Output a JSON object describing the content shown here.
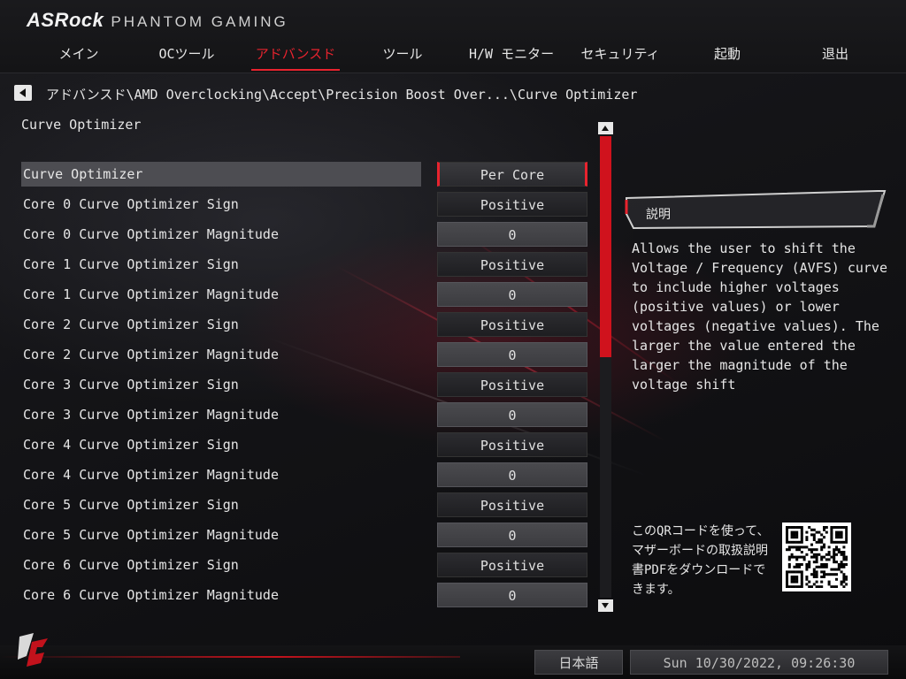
{
  "brand": {
    "logo": "ASRock",
    "subtitle": "PHANTOM GAMING"
  },
  "tabs": [
    {
      "label": "メイン"
    },
    {
      "label": "OCツール"
    },
    {
      "label": "アドバンスド",
      "active": true
    },
    {
      "label": "ツール"
    },
    {
      "label": "H/W モニター"
    },
    {
      "label": "セキュリティ"
    },
    {
      "label": "起動"
    },
    {
      "label": "退出"
    }
  ],
  "breadcrumb": "アドバンスド\\AMD Overclocking\\Accept\\Precision Boost Over...\\Curve Optimizer",
  "page_title": "Curve Optimizer",
  "settings": [
    {
      "label": "Curve Optimizer",
      "value": "Per Core",
      "kind": "select",
      "selected": true
    },
    {
      "label": "Core 0 Curve Optimizer Sign",
      "value": "Positive",
      "kind": "select"
    },
    {
      "label": "Core 0 Curve Optimizer Magnitude",
      "value": "0",
      "kind": "number"
    },
    {
      "label": "Core 1 Curve Optimizer Sign",
      "value": "Positive",
      "kind": "select"
    },
    {
      "label": "Core 1 Curve Optimizer Magnitude",
      "value": "0",
      "kind": "number"
    },
    {
      "label": "Core 2 Curve Optimizer Sign",
      "value": "Positive",
      "kind": "select"
    },
    {
      "label": "Core 2 Curve Optimizer Magnitude",
      "value": "0",
      "kind": "number"
    },
    {
      "label": "Core 3 Curve Optimizer Sign",
      "value": "Positive",
      "kind": "select"
    },
    {
      "label": "Core 3 Curve Optimizer Magnitude",
      "value": "0",
      "kind": "number"
    },
    {
      "label": "Core 4 Curve Optimizer Sign",
      "value": "Positive",
      "kind": "select"
    },
    {
      "label": "Core 4 Curve Optimizer Magnitude",
      "value": "0",
      "kind": "number"
    },
    {
      "label": "Core 5 Curve Optimizer Sign",
      "value": "Positive",
      "kind": "select"
    },
    {
      "label": "Core 5 Curve Optimizer Magnitude",
      "value": "0",
      "kind": "number"
    },
    {
      "label": "Core 6 Curve Optimizer Sign",
      "value": "Positive",
      "kind": "select"
    },
    {
      "label": "Core 6 Curve Optimizer Magnitude",
      "value": "0",
      "kind": "number"
    }
  ],
  "description": {
    "title": "説明",
    "text": "Allows the user to shift the Voltage / Frequency (AVFS) curve to include higher voltages (positive values) or lower voltages (negative values). The larger the value entered the larger the magnitude of the voltage shift"
  },
  "qr": {
    "text": "このQRコードを使って、マザーボードの取扱説明書PDFをダウンロードできます。"
  },
  "footer": {
    "language": "日本語",
    "datetime": "Sun 10/30/2022, 09:26:30"
  },
  "colors": {
    "accent": "#e8232e",
    "scroll_thumb": "#d0121d",
    "selected_row": "#4d4d52"
  }
}
